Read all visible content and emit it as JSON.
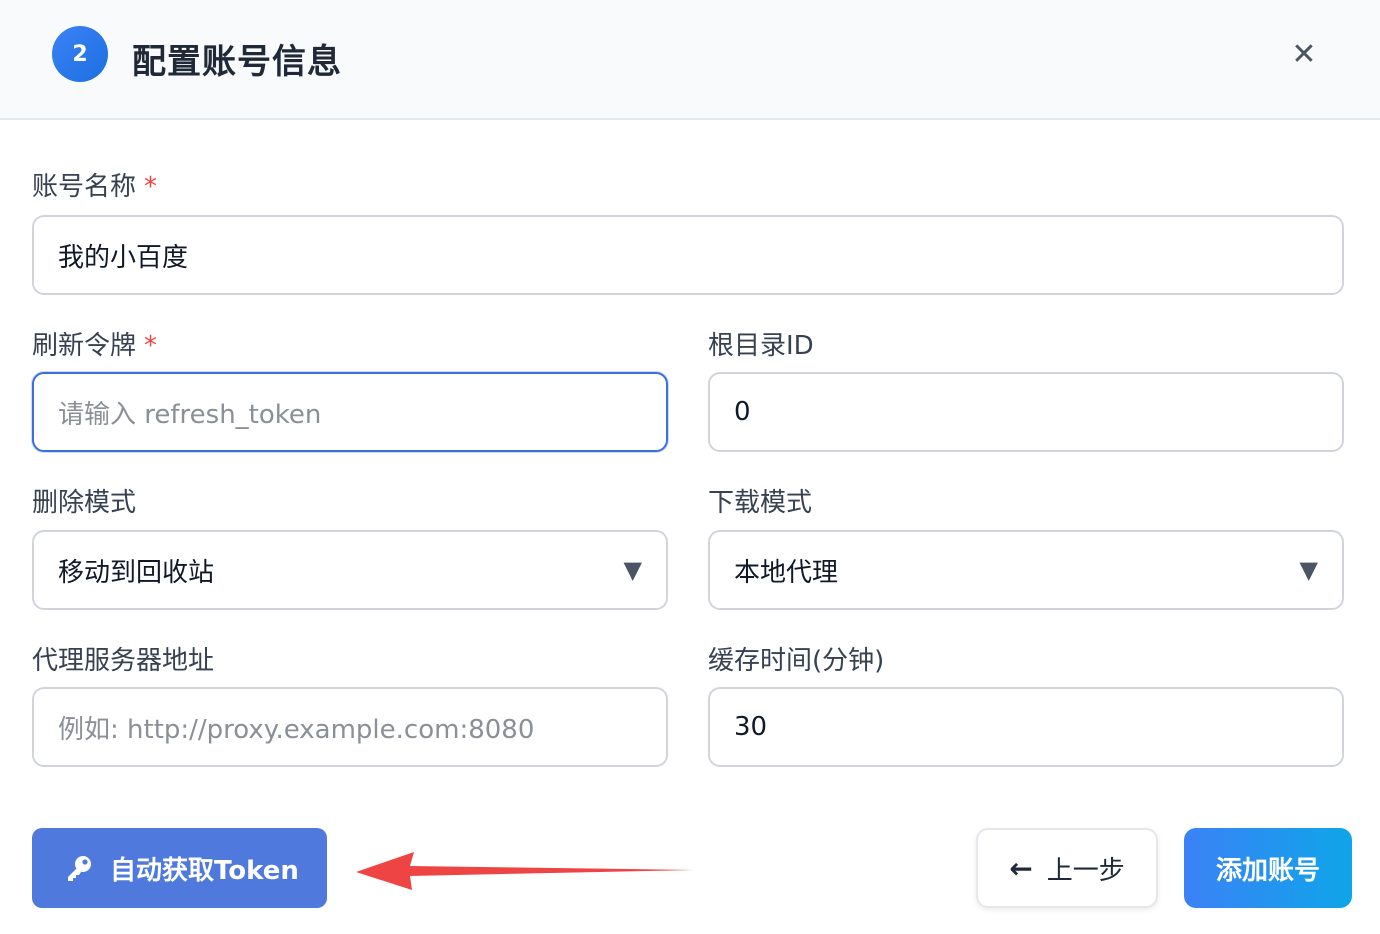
{
  "header": {
    "step_number": "2",
    "title": "配置账号信息",
    "close_icon": "close-icon"
  },
  "form": {
    "account_name": {
      "label": "账号名称",
      "required_mark": "*",
      "value": "我的小百度"
    },
    "refresh_token": {
      "label": "刷新令牌",
      "required_mark": "*",
      "placeholder": "请输入 refresh_token",
      "value": ""
    },
    "root_dir_id": {
      "label": "根目录ID",
      "value": "0"
    },
    "delete_mode": {
      "label": "删除模式",
      "selected": "移动到回收站"
    },
    "download_mode": {
      "label": "下载模式",
      "selected": "本地代理"
    },
    "proxy_address": {
      "label": "代理服务器地址",
      "placeholder": "例如: http://proxy.example.com:8080",
      "value": ""
    },
    "cache_time": {
      "label": "缓存时间(分钟)",
      "value": "30"
    }
  },
  "footer": {
    "auto_token_label": "自动获取Token",
    "auto_token_icon": "key-icon",
    "prev_label": "上一步",
    "prev_icon": "arrow-left-icon",
    "add_label": "添加账号"
  },
  "colors": {
    "primary": "#3b82f6",
    "auto_button": "#4f79dc",
    "required": "#ef4444",
    "annotation_arrow": "#ef4444"
  }
}
